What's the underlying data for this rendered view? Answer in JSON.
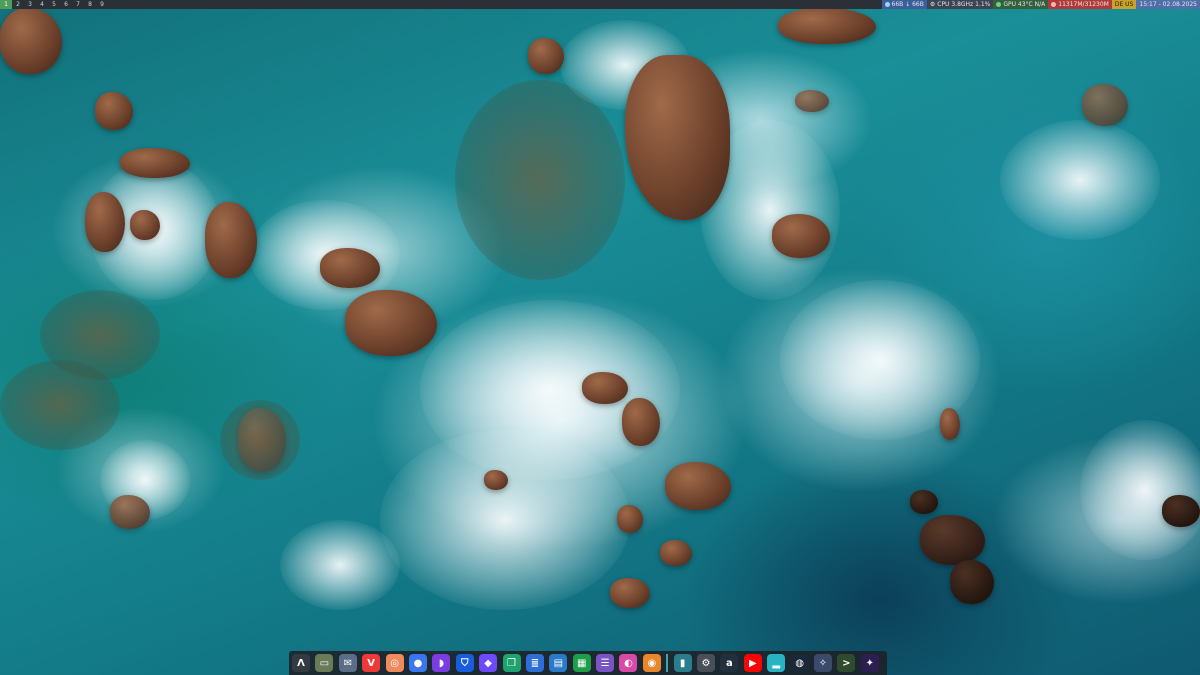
{
  "topbar": {
    "workspaces": [
      "1",
      "2",
      "3",
      "4",
      "5",
      "6",
      "7",
      "8",
      "9"
    ],
    "active_workspace": "1",
    "net_speed": "66B ↓ 66B",
    "cpu": "CPU 3.8GHz 1.1%",
    "gpu": "GPU 43°C N/A",
    "memory": "11317M/31230M",
    "keyboard_layout": "DE US",
    "clock": "15:17 - 02.08.2025"
  },
  "dock": {
    "apps": [
      {
        "name": "Arch Linux",
        "icon": "launcher-icon",
        "color": "#333a44",
        "glyph": "Λ"
      },
      {
        "name": "Files",
        "icon": "files-icon",
        "color": "#6b7a57",
        "glyph": "▭"
      },
      {
        "name": "Thunderbird",
        "icon": "thunderbird-icon",
        "color": "#5b6d87",
        "glyph": "✉"
      },
      {
        "name": "Vivaldi",
        "icon": "vivaldi-icon",
        "color": "#ef3939",
        "glyph": "V"
      },
      {
        "name": "Radio",
        "icon": "radio-icon",
        "color": "#f08a5d",
        "glyph": "◎"
      },
      {
        "name": "Signal",
        "icon": "signal-icon",
        "color": "#3a76f0",
        "glyph": "●"
      },
      {
        "name": "Podcasts",
        "icon": "podcast-icon",
        "color": "#7a3de0",
        "glyph": "◗"
      },
      {
        "name": "Bitwarden",
        "icon": "bitwarden-icon",
        "color": "#175ddc",
        "glyph": "⛉"
      },
      {
        "name": "Proton VPN",
        "icon": "protonvpn-icon",
        "color": "#6d4aff",
        "glyph": "◆"
      },
      {
        "name": "Chat",
        "icon": "chat-icon",
        "color": "#1ea36f",
        "glyph": "❐"
      },
      {
        "name": "Text Editor",
        "icon": "editor-icon",
        "color": "#2d6fd6",
        "glyph": "≣"
      },
      {
        "name": "Writer",
        "icon": "writer-icon",
        "color": "#2b79c9",
        "glyph": "▤"
      },
      {
        "name": "Calc",
        "icon": "calc-icon",
        "color": "#1f9e4a",
        "glyph": "▦"
      },
      {
        "name": "Notes",
        "icon": "notes-icon",
        "color": "#7a53c4",
        "glyph": "☰"
      },
      {
        "name": "Color Picker",
        "icon": "color-wheel-icon",
        "color": "#d94aa7",
        "glyph": "◐"
      },
      {
        "name": "Blender",
        "icon": "blender-icon",
        "color": "#e8872b",
        "glyph": "◉"
      },
      {
        "name": "Terminal",
        "icon": "terminal-icon",
        "color": "#2a7d8c",
        "glyph": "▮"
      },
      {
        "name": "Settings",
        "icon": "settings-icon",
        "color": "#4a4f57",
        "glyph": "⚙"
      },
      {
        "name": "Amazon",
        "icon": "amazon-icon",
        "color": "#232f3e",
        "glyph": "a"
      },
      {
        "name": "YouTube",
        "icon": "youtube-icon",
        "color": "#ff0000",
        "glyph": "▶"
      },
      {
        "name": "System Monitor",
        "icon": "monitor-icon",
        "color": "#27b3c2",
        "glyph": "▂"
      },
      {
        "name": "Steam",
        "icon": "steam-icon",
        "color": "#1b2838",
        "glyph": "◍"
      },
      {
        "name": "Anime Game",
        "icon": "game-icon",
        "color": "#3b4a6b",
        "glyph": "✧"
      },
      {
        "name": "Console",
        "icon": "console-icon",
        "color": "#2f4a2f",
        "glyph": ">"
      },
      {
        "name": "Heroic",
        "icon": "heroic-icon",
        "color": "#2b1f4f",
        "glyph": "✦"
      }
    ]
  },
  "colors": {
    "topbar_bg": "#2b2f36",
    "workspace_active": "#4f9d5a",
    "net_segment": "#3a5f9a",
    "cpu_segment": "#3b4452",
    "gpu_segment": "#3b4452",
    "mem_segment": "#b03a3a",
    "kbd_segment": "#c9a227",
    "clock_segment": "#4f6fa8",
    "dock_bg": "#1e2026"
  }
}
